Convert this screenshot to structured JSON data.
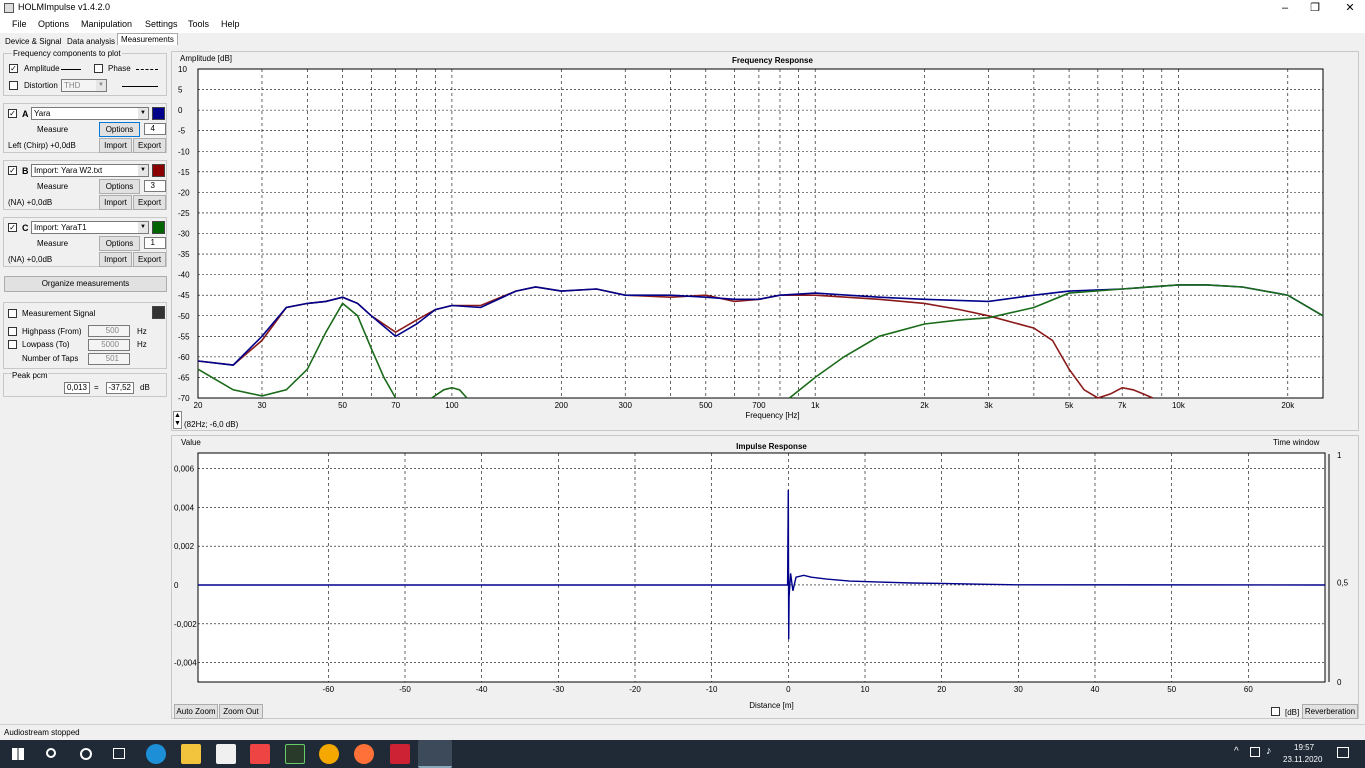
{
  "window": {
    "title": "HOLMImpulse  v1.4.2.0"
  },
  "menu": [
    "File",
    "Options",
    "Manipulation",
    "Settings",
    "Tools",
    "Help"
  ],
  "tabs": [
    "Device & Signal",
    "Data analysis",
    "Measurements"
  ],
  "components": {
    "title": "Frequency components to plot",
    "amplitude_label": "Amplitude",
    "amplitude_checked": true,
    "phase_label": "Phase",
    "phase_checked": false,
    "distortion_label": "Distortion",
    "distortion_checked": false,
    "distortion_select": "THD"
  },
  "measurements": [
    {
      "letter": "A",
      "checked": true,
      "name": "Yara",
      "color": "#00008b",
      "measure_label": "Measure",
      "options_label": "Options",
      "count": "4",
      "info": "Left (Chirp) +0,0dB",
      "import_label": "Import",
      "export_label": "Export"
    },
    {
      "letter": "B",
      "checked": true,
      "name": "Import: Yara W2.txt",
      "color": "#8b0000",
      "measure_label": "Measure",
      "options_label": "Options",
      "count": "3",
      "info": "(NA) +0,0dB",
      "import_label": "Import",
      "export_label": "Export"
    },
    {
      "letter": "C",
      "checked": true,
      "name": "Import: YaraT1",
      "color": "#006400",
      "measure_label": "Measure",
      "options_label": "Options",
      "count": "1",
      "info": "(NA) +0,0dB",
      "import_label": "Import",
      "export_label": "Export"
    }
  ],
  "organize_label": "Organize measurements",
  "signal": {
    "measurement_signal_label": "Measurement Signal",
    "highpass_label": "Highpass (From)",
    "highpass_value": "500",
    "highpass_unit": "Hz",
    "lowpass_label": "Lowpass (To)",
    "lowpass_value": "5000",
    "lowpass_unit": "Hz",
    "taps_label": "Number of Taps",
    "taps_value": "501"
  },
  "peak": {
    "label": "Peak pcm",
    "value": "0,013",
    "eq": "=",
    "db_value": "-37,52",
    "db_unit": "dB"
  },
  "status": "Audiostream stopped",
  "freq_cursor": "(82Hz; -6,0 dB)",
  "impulse_controls": {
    "auto_zoom": "Auto Zoom",
    "zoom_out": "Zoom Out",
    "db_label": "[dB]",
    "reverberation": "Reverberation"
  },
  "clock": {
    "time": "19:57",
    "date": "23.11.2020"
  },
  "chart_data": [
    {
      "type": "line",
      "title": "Frequency Response",
      "ylabel": "Amplitude [dB]",
      "xlabel": "Frequency [Hz]",
      "x_scale": "log",
      "xlim": [
        20,
        25000
      ],
      "ylim": [
        -70,
        10
      ],
      "y_ticks": [
        10,
        5,
        0,
        -5,
        -10,
        -15,
        -20,
        -25,
        -30,
        -35,
        -40,
        -45,
        -50,
        -55,
        -60,
        -65,
        -70
      ],
      "x_tick_labels": [
        "20",
        "30",
        "50",
        "70",
        "100",
        "200",
        "300",
        "500",
        "700",
        "1k",
        "2k",
        "3k",
        "5k",
        "7k",
        "10k",
        "20k"
      ],
      "x_tick_values": [
        20,
        30,
        50,
        70,
        100,
        200,
        300,
        500,
        700,
        1000,
        2000,
        3000,
        5000,
        7000,
        10000,
        20000
      ],
      "grid": true,
      "series": [
        {
          "color": "#8b1a1a",
          "x": [
            20,
            25,
            30,
            35,
            40,
            45,
            50,
            55,
            60,
            70,
            80,
            90,
            100,
            120,
            150,
            170,
            200,
            250,
            300,
            400,
            500,
            600,
            700,
            800,
            1000,
            1500,
            2000,
            2500,
            3000,
            4000,
            4500,
            5000,
            5500,
            6000,
            6500,
            7000,
            7500,
            8000,
            8500
          ],
          "y": [
            -61,
            -62,
            -56,
            -48,
            -47,
            -46.5,
            -45.5,
            -47,
            -50,
            -54,
            -51,
            -48.5,
            -47.5,
            -47.5,
            -44,
            -43,
            -44,
            -43.5,
            -45,
            -45.5,
            -45,
            -46.5,
            -46,
            -45,
            -45,
            -46,
            -47,
            -48.5,
            -50,
            -53,
            -56,
            -63,
            -68,
            -70,
            -69,
            -67.5,
            -68,
            -69,
            -70
          ]
        },
        {
          "color": "#00008b",
          "x": [
            20,
            25,
            30,
            35,
            40,
            45,
            50,
            55,
            60,
            70,
            80,
            90,
            100,
            120,
            150,
            170,
            200,
            250,
            300,
            400,
            500,
            600,
            700,
            800,
            1000,
            1500,
            2000,
            3000,
            4000,
            5000,
            7000,
            10000,
            12000,
            15000,
            20000,
            25000
          ],
          "y": [
            -61,
            -62,
            -55,
            -48,
            -47,
            -46.5,
            -45.5,
            -47,
            -50,
            -55,
            -52,
            -48.5,
            -47.5,
            -48,
            -44,
            -43,
            -44,
            -43.5,
            -45,
            -45,
            -45.5,
            -46,
            -46,
            -45,
            -44.5,
            -45.5,
            -46,
            -46.5,
            -45,
            -44,
            -43.5,
            -42.5,
            -42.5,
            -43,
            -45,
            -50
          ]
        },
        {
          "color": "#1a6b1a",
          "x": [
            20,
            25,
            30,
            35,
            40,
            45,
            50,
            55,
            60,
            65,
            70
          ],
          "y": [
            -63,
            -68,
            -69.5,
            -68,
            -63,
            -54,
            -47,
            -50,
            -58,
            -65,
            -70
          ]
        },
        {
          "color": "#1a6b1a",
          "x": [
            88,
            95,
            100,
            105,
            110
          ],
          "y": [
            -70,
            -68,
            -67.5,
            -68,
            -70
          ]
        },
        {
          "color": "#1a6b1a",
          "x": [
            850,
            1000,
            1200,
            1500,
            2000,
            2500,
            3000,
            4000,
            5000,
            7000,
            10000,
            12000,
            15000,
            20000,
            25000
          ],
          "y": [
            -70,
            -65,
            -60,
            -55,
            -52,
            -51,
            -50.5,
            -48,
            -44.5,
            -43.5,
            -42.5,
            -42.5,
            -43,
            -45,
            -50
          ]
        }
      ]
    },
    {
      "type": "line",
      "title": "Impulse Response",
      "ylabel": "Value",
      "xlabel": "Distance [m]",
      "y2label": "Time window",
      "xlim": [
        -77,
        70
      ],
      "ylim": [
        -0.005,
        0.0068
      ],
      "y_ticks": [
        0.006,
        0.004,
        0.002,
        0,
        -0.002,
        -0.004
      ],
      "y_tick_labels": [
        "0,006",
        "0,004",
        "0,002",
        "0",
        "-0,002",
        "-0,004"
      ],
      "x_ticks": [
        -60,
        -50,
        -40,
        -30,
        -20,
        -10,
        0,
        10,
        20,
        30,
        40,
        50,
        60
      ],
      "y2_ticks": [
        "1",
        "0,5",
        "0"
      ],
      "grid": true,
      "series": [
        {
          "color": "#00008b",
          "x": [
            -77,
            -0.1,
            0,
            0.05,
            0.1,
            0.3,
            0.6,
            1,
            2,
            3,
            5,
            8,
            12,
            16,
            20,
            25,
            30,
            70
          ],
          "y": [
            0,
            0,
            0.0049,
            -0.0028,
            -0.0006,
            0.0006,
            -0.0003,
            0.0004,
            0.0005,
            0.0004,
            0.0003,
            0.0002,
            0.00015,
            0.0001,
            8e-05,
            4e-05,
            1e-05,
            0
          ]
        }
      ]
    }
  ]
}
